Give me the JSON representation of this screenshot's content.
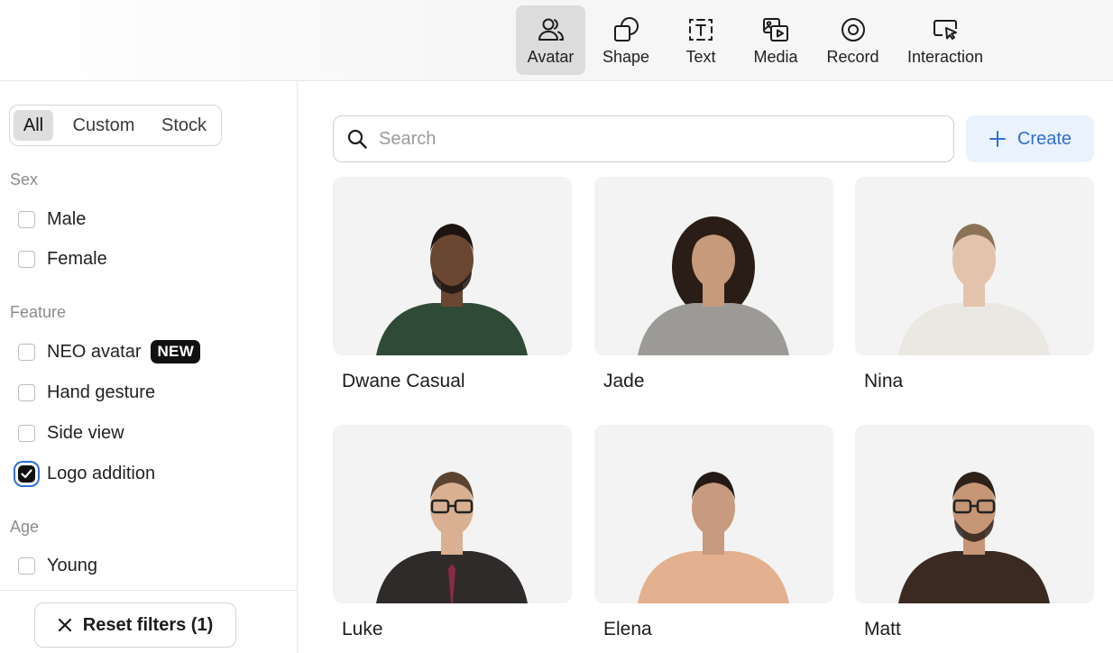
{
  "toolbar": {
    "items": [
      {
        "label": "Avatar",
        "icon": "avatar-icon",
        "active": true
      },
      {
        "label": "Shape",
        "icon": "shape-icon",
        "active": false
      },
      {
        "label": "Text",
        "icon": "text-icon",
        "active": false
      },
      {
        "label": "Media",
        "icon": "media-icon",
        "active": false
      },
      {
        "label": "Record",
        "icon": "record-icon",
        "active": false
      },
      {
        "label": "Interaction",
        "icon": "interaction-icon",
        "active": false
      }
    ]
  },
  "sidebar": {
    "segments": [
      {
        "label": "All",
        "active": true
      },
      {
        "label": "Custom",
        "active": false
      },
      {
        "label": "Stock",
        "active": false
      }
    ],
    "groups": [
      {
        "title": "Sex",
        "options": [
          {
            "label": "Male",
            "checked": false
          },
          {
            "label": "Female",
            "checked": false
          }
        ]
      },
      {
        "title": "Feature",
        "options": [
          {
            "label": "NEO avatar",
            "checked": false,
            "badge": "NEW"
          },
          {
            "label": "Hand gesture",
            "checked": false
          },
          {
            "label": "Side view",
            "checked": false
          },
          {
            "label": "Logo addition",
            "checked": true
          }
        ]
      },
      {
        "title": "Age",
        "options": [
          {
            "label": "Young",
            "checked": false
          }
        ]
      }
    ],
    "reset_label": "Reset filters (1)"
  },
  "main": {
    "search_placeholder": "Search",
    "create_label": "Create",
    "accent_color": "#2f6fd6",
    "avatars": [
      {
        "name": "Dwane Casual",
        "skin": "#6b4632",
        "hair": "#1d1410",
        "top": "#2f4a36",
        "beard": true
      },
      {
        "name": "Jade",
        "skin": "#c79a7c",
        "hair": "#2a1c16",
        "top": "#9c9a97",
        "curly": true
      },
      {
        "name": "Nina",
        "skin": "#e4c3ad",
        "hair": "#8c7357",
        "top": "#ebe8e4"
      },
      {
        "name": "Luke",
        "skin": "#d9b091",
        "hair": "#5a4330",
        "top": "#2e2b2a",
        "glasses": true,
        "tie": "#8a2a45"
      },
      {
        "name": "Elena",
        "skin": "#c89a7f",
        "hair": "#231915",
        "top": "#e3b090"
      },
      {
        "name": "Matt",
        "skin": "#c69676",
        "hair": "#2d211a",
        "top": "#3a2a22",
        "glasses": true,
        "beard": true
      }
    ]
  }
}
